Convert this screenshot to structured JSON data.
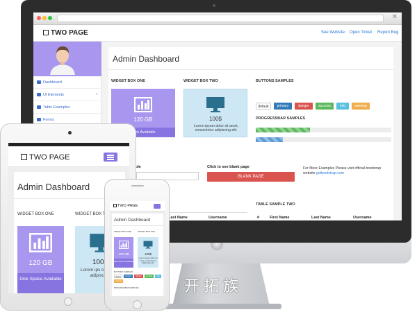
{
  "watermark": "开拓族",
  "brand": "TWO PAGE",
  "top_nav": [
    "See Website",
    "Open Ticket",
    "Report Bug"
  ],
  "sidebar": {
    "items": [
      {
        "label": "Dashboard",
        "has_chevron": false
      },
      {
        "label": "UI Elements",
        "has_chevron": true
      },
      {
        "label": "Table Examples",
        "has_chevron": false
      },
      {
        "label": "Forms",
        "has_chevron": false
      }
    ]
  },
  "main": {
    "title": "Admin Dashboard",
    "widget_one": {
      "title": "WIDGET BOX ONE",
      "value": "120 GB",
      "footer": "Disk Space Available",
      "footer_partial": "pace Available",
      "icon": "bar-chart-icon"
    },
    "widget_two": {
      "title": "WIDGET BOX TWO",
      "title_partial": "WIDGET BOX T",
      "value": "100$",
      "text": "Lorem ipsum dolor sit amet, consectetur adipiscing elit.",
      "text_partial": "Lorem ips consecte adipiscing",
      "icon": "monitor-icon"
    },
    "buttons_title": "BUTTONS SAMPLES",
    "buttons": [
      {
        "label": "default",
        "color": "#ffffff",
        "text_color": "#333333"
      },
      {
        "label": "primary",
        "color": "#337ab7",
        "text_color": "#ffffff"
      },
      {
        "label": "danger",
        "color": "#d9534f",
        "text_color": "#ffffff"
      },
      {
        "label": "success",
        "color": "#5cb85c",
        "text_color": "#ffffff"
      },
      {
        "label": "info",
        "color": "#5bc0de",
        "text_color": "#ffffff"
      },
      {
        "label": "warning",
        "color": "#f0ad4e",
        "text_color": "#ffffff"
      }
    ],
    "progress_title": "PROGRESSBAR SAMPLES",
    "progress": [
      {
        "value": 0.4,
        "color": "#5cb85c"
      },
      {
        "value": 0.2,
        "color": "#5b9bd5"
      }
    ],
    "input_label_partial": "mple",
    "blank_label": "Click to see blank page",
    "blank_button": "BLANK PAGE",
    "info_text": "For More Examples Please visit official bootstrap website",
    "info_link": "getbootstrap.com",
    "table_one_headers": [
      "Last Name",
      "Username"
    ],
    "table_two_title": "TABLE SAMPLE TWO",
    "table_two_headers": [
      "#",
      "First Name",
      "Last Name",
      "Username"
    ]
  },
  "ipad": {
    "brand": "TWO PAGE",
    "title": "Admin Dashboard",
    "widget_one_title": "WIDGET BOX ONE",
    "widget_two_title": "WIDGET BOX T",
    "value_one": "120 GB",
    "footer_one": "Disk Space Available",
    "value_two": "100$",
    "text_two": "Lorem ips consecte adipiscing"
  },
  "iphone": {
    "brand": "TWO PAGE",
    "title": "Admin Dashboard",
    "widget_one_title": "WIDGET BOX ONE",
    "widget_two_title": "WIDGET BOX TWO",
    "value_one": "120 GB",
    "footer_one": "Disk Space Available",
    "value_two": "100$",
    "text_two": "Lorem ipsum dolor sit amet, consectetur adipiscing elit.",
    "buttons_title": "BUTTONS SAMPLES",
    "buttons": [
      "default",
      "primary",
      "danger",
      "success",
      "info",
      "warning"
    ],
    "progress_title": "PROGRESSBAR SAMPLES"
  }
}
